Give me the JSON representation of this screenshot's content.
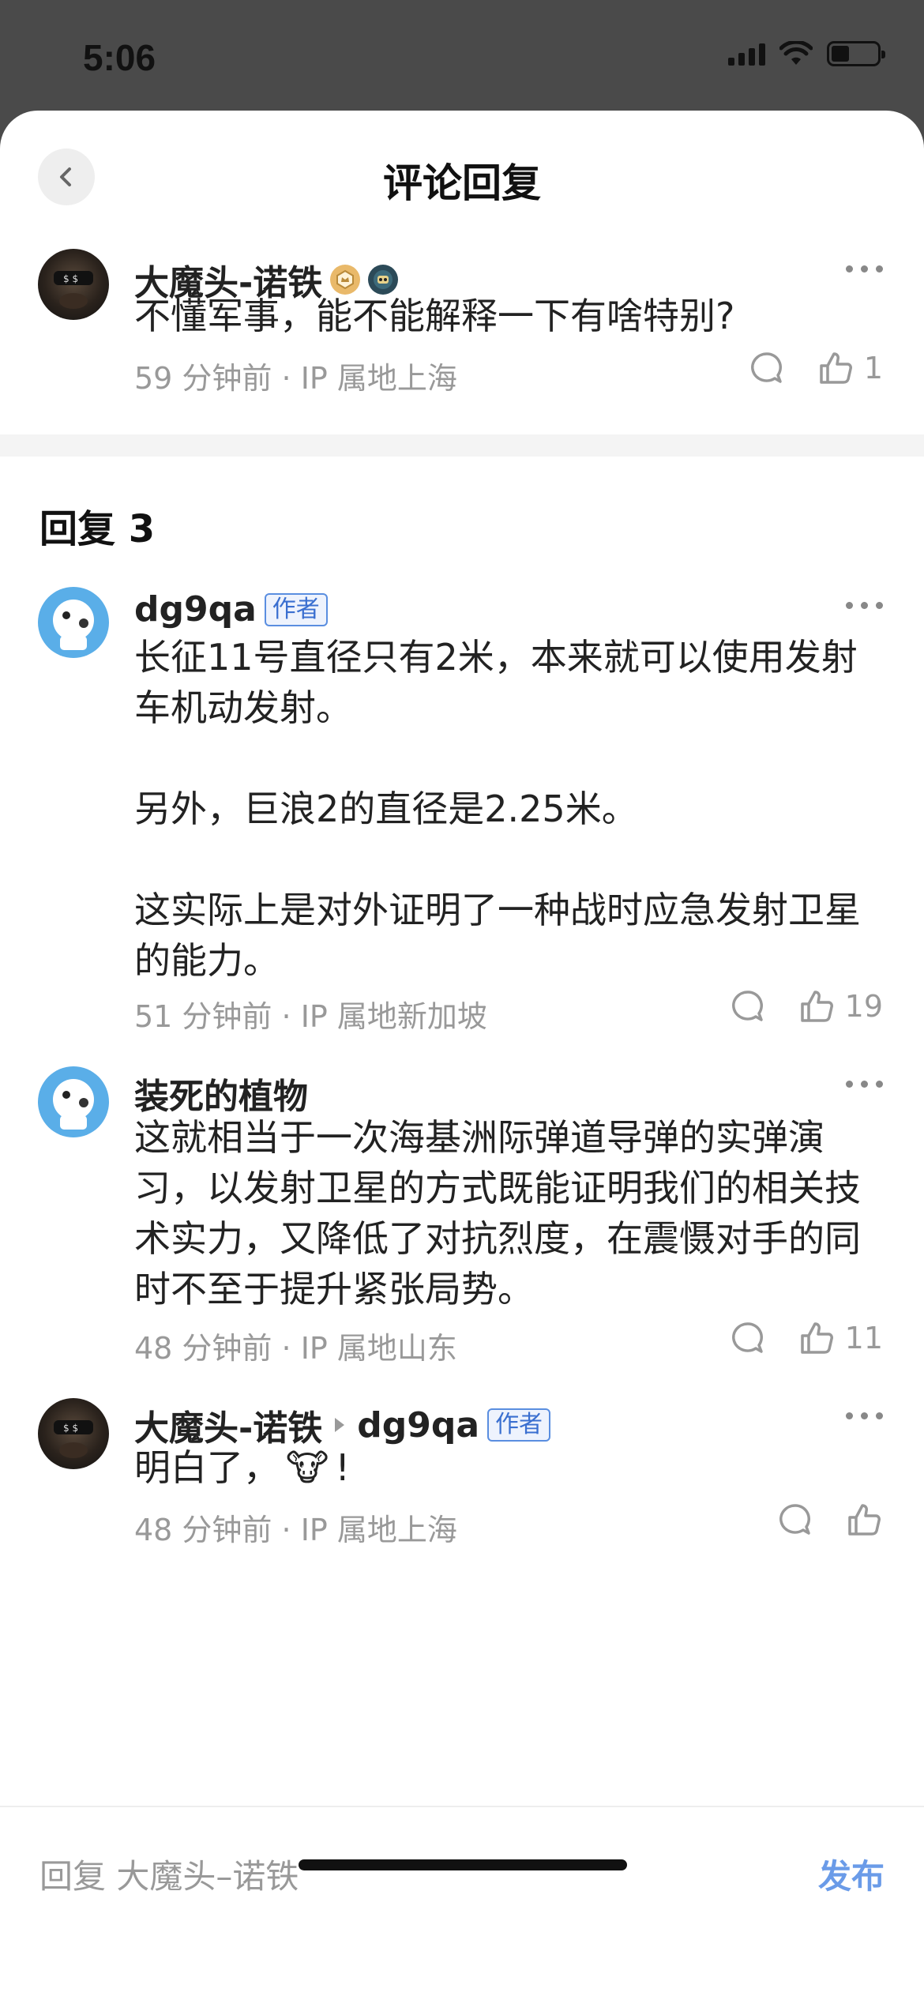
{
  "status_bar": {
    "time": "5:06"
  },
  "header": {
    "title": "评论回复"
  },
  "root_comment": {
    "author": "大魔头-诺铁",
    "content": "不懂军事，能不能解释一下有啥特别?",
    "time": "59 分钟前",
    "location": "· IP 属地上海",
    "likes": "1"
  },
  "replies_section": {
    "title": "回复 3"
  },
  "replies": [
    {
      "author": "dg9qa",
      "badge": "作者",
      "content": "长征11号直径只有2米，本来就可以使用发射车机动发射。\n\n另外，巨浪2的直径是2.25米。\n\n这实际上是对外证明了一种战时应急发射卫星的能力。",
      "time": "51 分钟前",
      "location": "· IP 属地新加坡",
      "likes": "19"
    },
    {
      "author": "装死的植物",
      "content": "这就相当于一次海基洲际弹道导弹的实弹演习，以发射卫星的方式既能证明我们的相关技术实力，又降低了对抗烈度，在震慑对手的同时不至于提升紧张局势。",
      "time": "48 分钟前",
      "location": "· IP 属地山东",
      "likes": "11"
    },
    {
      "author": "大魔头-诺铁",
      "reply_to": "dg9qa",
      "reply_to_badge": "作者",
      "content_text": "明白了，",
      "content_emoji": "🐮",
      "content_end": "!",
      "time": "48 分钟前",
      "location": "· IP 属地上海"
    }
  ],
  "bottom_bar": {
    "placeholder": "回复 大魔头–诺铁",
    "publish_label": "发布"
  },
  "colors": {
    "accent": "#6a9be8",
    "author_badge": "#3a6fd0",
    "meta_text": "#999999"
  },
  "icons": [
    "back-chevron-icon",
    "more-dots-icon",
    "comment-bubble-icon",
    "thumbs-up-icon",
    "crown-medal-icon",
    "robot-medal-icon",
    "reply-arrow-icon"
  ]
}
